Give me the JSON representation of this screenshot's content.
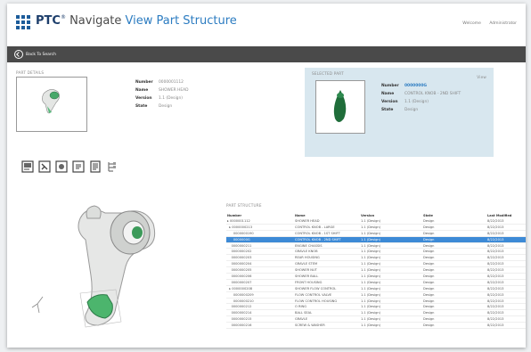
{
  "app": {
    "brand": "PTC",
    "product": "Navigate",
    "view": "View Part Structure"
  },
  "header_links": [
    "Welcome",
    "Administrator"
  ],
  "toolbar": {
    "back_label": "Back To Search"
  },
  "part_details": {
    "title": "PART DETAILS",
    "props": [
      {
        "k": "Number",
        "v": "0000001112"
      },
      {
        "k": "Name",
        "v": "SHOWER HEAD"
      },
      {
        "k": "Version",
        "v": "1.1 (Design)"
      },
      {
        "k": "State",
        "v": "Design"
      }
    ]
  },
  "selected_part": {
    "title": "SELECTED PART",
    "action": "View",
    "props": [
      {
        "k": "Number",
        "v": "0000000G"
      },
      {
        "k": "Name",
        "v": "CONTROL KNOB - 2ND SHIFT"
      },
      {
        "k": "Version",
        "v": "1.1 (Design)"
      },
      {
        "k": "State",
        "v": "Design"
      }
    ]
  },
  "action_icons": [
    "view-part-icon",
    "edit-part-icon",
    "settings-part-icon",
    "export-part-icon",
    "document-icon",
    "structure-tree-icon"
  ],
  "structure": {
    "title": "PART STRUCTURE",
    "columns": [
      "Number",
      "Name",
      "Version",
      "State",
      "Last Modified"
    ],
    "rows": [
      [
        "▸ 0000001112",
        "SHOWER HEAD",
        "1.1 (Design)",
        "Design",
        "8/22/2013"
      ],
      [
        "  ▸ 0000000213",
        "CONTROL KNOB - LARGE",
        "1.1 (Design)",
        "Design",
        "8/22/2013"
      ],
      [
        "      0000000190",
        "CONTROL KNOB - 1ST SHIFT",
        "1.1 (Design)",
        "Design",
        "8/22/2013"
      ],
      [
        "      0000000G",
        "CONTROL KNOB - 2ND SHIFT",
        "1.1 (Design)",
        "Design",
        "8/22/2013"
      ],
      [
        "    0000000211",
        "ENGINE CHASSIS",
        "1.1 (Design)",
        "Design",
        "8/22/2013"
      ],
      [
        "    0000000202",
        "GRAVLE KNOB",
        "1.1 (Design)",
        "Design",
        "8/22/2013"
      ],
      [
        "    0000000203",
        "REAR HOUSING",
        "1.1 (Design)",
        "Design",
        "8/22/2013"
      ],
      [
        "    0000000204",
        "GRAVLE STEM",
        "1.1 (Design)",
        "Design",
        "8/22/2013"
      ],
      [
        "    0000000205",
        "SHOWER NUT",
        "1.1 (Design)",
        "Design",
        "8/22/2013"
      ],
      [
        "    0000000206",
        "SHOWER BALL",
        "1.1 (Design)",
        "Design",
        "8/22/2013"
      ],
      [
        "    0000000207",
        "FRONT HOUSING",
        "1.1 (Design)",
        "Design",
        "8/22/2013"
      ],
      [
        "  ▸ 0000000208",
        "SHOWER FLOW CONTROL",
        "1.1 (Design)",
        "Design",
        "8/22/2013"
      ],
      [
        "      0000000209",
        "FLOW CONTROL VALVE",
        "1.1 (Design)",
        "Design",
        "8/22/2013"
      ],
      [
        "      0000000210",
        "FLOW CONTROL HOUSING",
        "1.1 (Design)",
        "Design",
        "8/22/2013"
      ],
      [
        "    0000000212",
        "O RING",
        "1.1 (Design)",
        "Design",
        "8/22/2013"
      ],
      [
        "    0000000214",
        "BALL SEAL",
        "1.1 (Design)",
        "Design",
        "8/22/2013"
      ],
      [
        "    0000000215",
        "GRAVLE",
        "1.1 (Design)",
        "Design",
        "8/22/2013"
      ],
      [
        "    0000000216",
        "SCREW & WASHER",
        "1.1 (Design)",
        "Design",
        "8/22/2013"
      ]
    ],
    "selected_index": 3
  }
}
